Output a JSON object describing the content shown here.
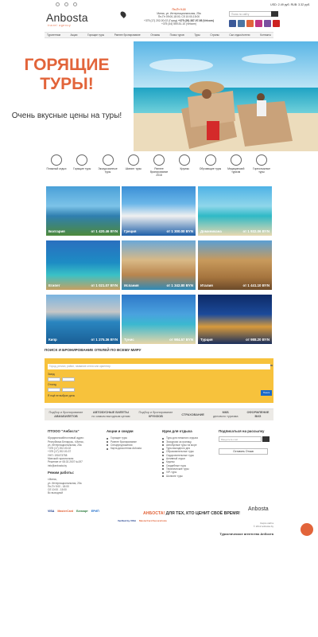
{
  "header": {
    "logo": "Anbosta",
    "logo_sub": "travel agency",
    "schedule": "Пн-Пт 9-18",
    "address": "Минск, ул. Интернациональная, 25а",
    "hours": "Пн-Пт 09:00-18:00, Сб 10:00-15:00",
    "phone1": "+375 (17) 202-00-02 (Город)",
    "phone2": "+375 (29) 387-97-98 (Velcom)",
    "phone3": "+375 (44) 559-51-10 (Velcom)",
    "rates": "USD: 2.49 руб.  RUB: 3.32 руб.",
    "search_placeholder": "Поиск по сайту"
  },
  "nav": [
    "Турагентам",
    "Акции",
    "Горящие туры",
    "Раннее бронирование",
    "Отзывы",
    "Поиск туров",
    "Туры",
    "Страны",
    "Ски отдых/хотели",
    "Контакты"
  ],
  "hero": {
    "title": "ГОРЯЩИЕ ТУРЫ!",
    "subtitle": "Очень вкусные цены на туры!"
  },
  "categories": [
    "Пляжный отдых",
    "Горящие туры",
    "Экскурсионные туры",
    "Шопинг туры",
    "Раннее бронирование 2018",
    "Круизы",
    "Обучающие туры",
    "Медицинский туризм",
    "Горнолыжные туры"
  ],
  "destinations": [
    {
      "name": "Болгария",
      "price": "от 1 420.46 BYN"
    },
    {
      "name": "Греция",
      "price": "от 1 300.00 BYN"
    },
    {
      "name": "Доминикана",
      "price": "от 1 932.06 BYN"
    },
    {
      "name": "Египет",
      "price": "от 1 021.07 BYN"
    },
    {
      "name": "Испания",
      "price": "от 1 342.80 BYN"
    },
    {
      "name": "Италия",
      "price": "от 1 441.10 BYN"
    },
    {
      "name": "Кипр",
      "price": "от 1 275.36 BYN"
    },
    {
      "name": "Тунис",
      "price": "от 984.57 BYN"
    },
    {
      "name": "Турция",
      "price": "от 988.20 BYN"
    }
  ],
  "booking": {
    "title": "ПОИСК И БРОНИРОВАНИЕ ОТЕЛЕЙ ПО ВСЕМУ МИРУ",
    "brand": "Booking.com",
    "placeholder": "Город, регион, район, название отеля или ориентир",
    "checkin": "Заезд",
    "checkout": "Отъезд",
    "nodates": "Я ещё не выбрал даты",
    "button": "Поиск"
  },
  "services": [
    {
      "line1": "Подбор и бронирование",
      "line2": "АВИАБИЛЕТОВ"
    },
    {
      "line1": "АВТОБУСНЫЕ БИЛЕТЫ",
      "line2": "по самым выгодным ценам"
    },
    {
      "line1": "Подбор и бронирование",
      "line2": "КРУИЗОВ"
    },
    {
      "line1": "СТРАХОВАНИЕ",
      "line2": ""
    },
    {
      "line1": "МКБ",
      "line2": "делового туризма"
    },
    {
      "line1": "ОФОРМЛЕНИЕ",
      "line2": "ВИЗ"
    }
  ],
  "footer": {
    "company_title": "ПТООО \"Анбоста\"",
    "company_text": [
      "Юридический/почтовый адрес:",
      "Республика Беларусь, г.Минск,",
      "ул. Интернациональная, 25а",
      "+375 (17) 202-00-02",
      "+375 (17) 202-00-37",
      "УНП: 190473758",
      "Минский горисполком",
      "Решение от 08.02.2007 №197",
      "info@anbosta.by"
    ],
    "hours_title": "Режим работы:",
    "hours_text": [
      "г.Минск,",
      "ул. Интернациональная, 25а",
      "Пн-Пт 9:00 - 18:00",
      "Сб 10:00 - 15:00",
      "Вс выходной"
    ],
    "promos_title": "Акции и скидки",
    "promos": [
      "Горящие туры",
      "Раннее бронирование",
      "Спецпредложения",
      "Карта дисконтная Anbosta"
    ],
    "ideas_title": "Идеи для отдыха",
    "ideas": [
      "Туры для пляжного отдыха",
      "Экскурсии за границу",
      "Автобусные туры на море",
      "Туры выходного дня",
      "Образовательные туры",
      "Оздоровительные туры",
      "Активный отдых",
      "Круизы",
      "Свадебные туры",
      "Тематические туры",
      "VIP-туры",
      "Шоппинг туры"
    ],
    "subscribe_title": "Подписаться на рассылку",
    "subscribe_placeholder": "Введите E-mail",
    "review_button": "Оставить Отзыв",
    "payments": [
      "VISA",
      "MasterCard",
      "Белкарт",
      "ЕРИП",
      "Verified by VISA",
      "MasterCard SecureCode"
    ],
    "slogan_accent": "АНБОСТА!",
    "slogan_rest": "ДЛЯ ТЕХ, КТО ЦЕНИТ СВОЁ ВРЕМЯ!",
    "brand2": "Anbosta",
    "copy1": "Карта сайта",
    "copy2": "© 2012 anbosta.by",
    "agency": "Туристическое агентство Анбоста"
  },
  "colors": {
    "accent": "#e2643a",
    "booking": "#f7c23c",
    "booking_button": "#1b6ac9"
  }
}
